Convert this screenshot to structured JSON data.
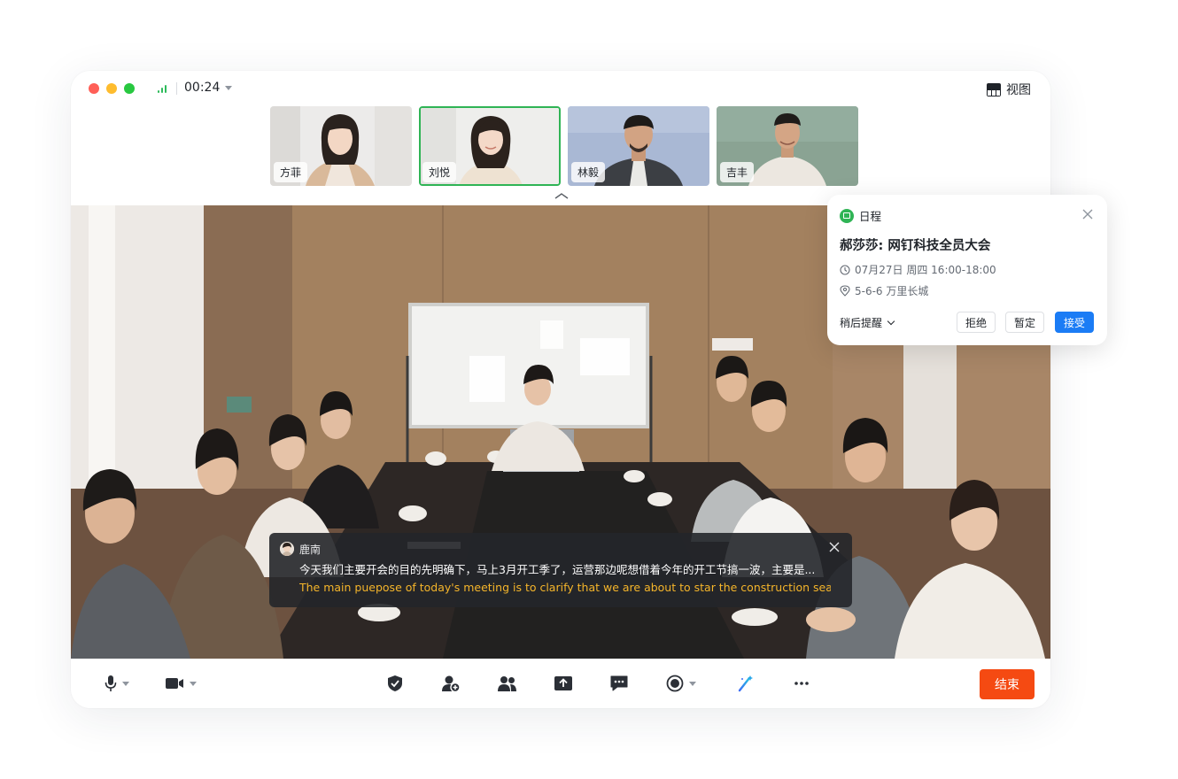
{
  "call": {
    "duration": "00:24",
    "view_label": "视图",
    "end_label": "结束"
  },
  "participants": [
    {
      "name": "方菲",
      "active": false
    },
    {
      "name": "刘悦",
      "active": true
    },
    {
      "name": "林毅",
      "active": false
    },
    {
      "name": "吉丰",
      "active": false
    }
  ],
  "caption": {
    "speaker": "鹿南",
    "original": "今天我们主要开会的目的先明确下，马上3月开工季了，运营那边呢想借着今年的开工节搞一波，主要是...",
    "translation": "The main puepose of today's meeting is to clarify that we are about to star the construction seas..."
  },
  "schedule": {
    "header": "日程",
    "title": "郝莎莎: 网钉科技全员大会",
    "time": "07月27日 周四 16:00-18:00",
    "location": "5-6-6 万里长城",
    "remind_label": "稍后提醒",
    "decline_label": "拒绝",
    "tentative_label": "暂定",
    "accept_label": "接受"
  },
  "toolbar": {
    "icons": [
      "microphone-icon",
      "camera-icon",
      "security-icon",
      "invite-icon",
      "participants-icon",
      "share-screen-icon",
      "chat-icon",
      "record-icon",
      "magic-icon",
      "more-icon"
    ]
  },
  "colors": {
    "end_button": "#f54a12",
    "accept_button": "#1b7cf5",
    "active_speaker_border": "#2fb455",
    "translation_text": "#f5b52a"
  }
}
